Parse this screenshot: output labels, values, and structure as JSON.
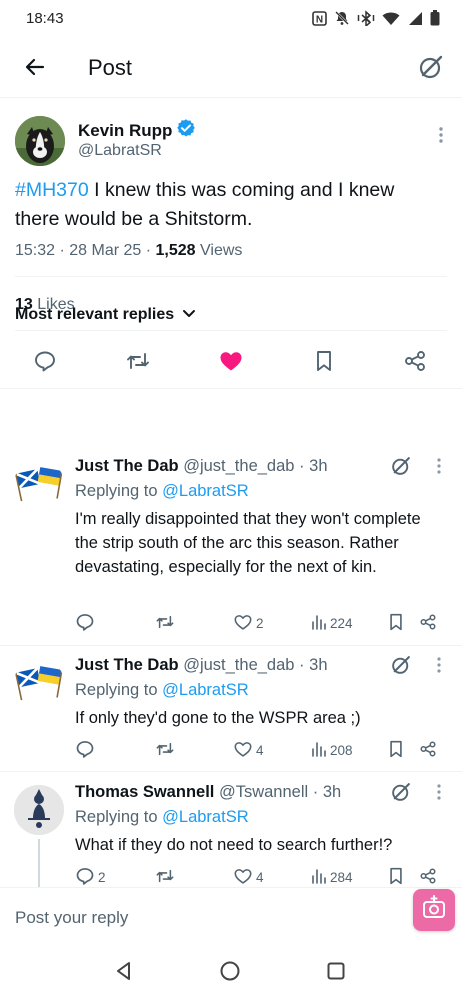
{
  "status_bar": {
    "time": "18:43",
    "icons": [
      "nfc-icon",
      "mute-icon",
      "bluetooth-vibrate-icon",
      "wifi-icon",
      "signal-icon",
      "battery-icon"
    ]
  },
  "header": {
    "title": "Post",
    "back_icon": "arrow-left-icon",
    "grok_icon": "grok-icon"
  },
  "post": {
    "author_name": "Kevin Rupp",
    "author_handle": "@LabratSR",
    "verified": true,
    "hashtag": "#MH370",
    "text": " I knew this was coming and I knew there would be a Shitstorm.",
    "time": "15:32",
    "date": "28 Mar 25",
    "views_count": "1,528",
    "views_label": "Views",
    "likes_count": "13",
    "likes_label": "Likes",
    "liked": true
  },
  "replies_filter": {
    "label": "Most relevant replies"
  },
  "replies": [
    {
      "name": "Just The Dab",
      "handle": "@just_the_dab",
      "age": "3h",
      "replying_prefix": "Replying to",
      "replying_handle": "@LabratSR",
      "text": "I'm really disappointed that they won't complete the strip south of the arc this season. Rather devastating, especially for the next of kin.",
      "replies": "",
      "retweets": "",
      "likes": "2",
      "views": "224"
    },
    {
      "name": "Just The Dab",
      "handle": "@just_the_dab",
      "age": "3h",
      "replying_prefix": "Replying to",
      "replying_handle": "@LabratSR",
      "text": "If only they'd gone to the WSPR area ;)",
      "replies": "",
      "retweets": "",
      "likes": "4",
      "views": "208"
    },
    {
      "name": "Thomas Swannell",
      "handle": "@Tswannell",
      "age": "3h",
      "replying_prefix": "Replying to",
      "replying_handle": "@LabratSR",
      "text": "What if they do not need to search further!?",
      "replies": "2",
      "retweets": "",
      "likes": "4",
      "views": "284"
    }
  ],
  "compose": {
    "placeholder": "Post your reply"
  },
  "colors": {
    "accent": "#1d9bf0",
    "like": "#f91880",
    "muted_text": "#536471",
    "fab": "#ec6aa6"
  }
}
